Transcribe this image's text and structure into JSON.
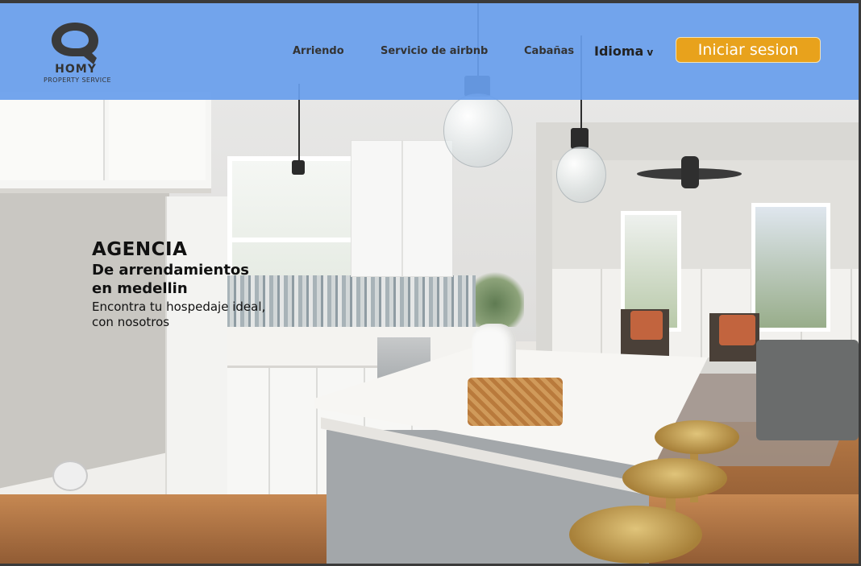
{
  "brand": {
    "name": "HOMY",
    "tagline": "PROPERTY SERVICE"
  },
  "nav": {
    "arriendo": "Arriendo",
    "airbnb": "Servicio de airbnb",
    "cabanas": "Cabañas",
    "idioma": "Idioma",
    "idioma_chevron": "v",
    "login": "Iniciar sesion"
  },
  "hero": {
    "title": "AGENCIA",
    "subtitle_line1": "De arrendamientos",
    "subtitle_line2": "en medellin",
    "desc_line1": "Encontra tu hospedaje ideal,",
    "desc_line2": "con nosotros"
  },
  "colors": {
    "header_bg": "#689EEC",
    "login_button": "#E8A21C",
    "text_dark": "#333333"
  },
  "icons": {
    "logo": "homy-q-house-logo"
  }
}
